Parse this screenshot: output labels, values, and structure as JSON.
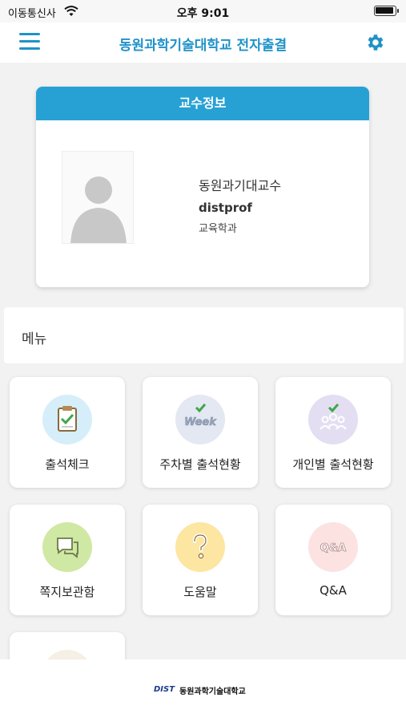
{
  "status_bar": {
    "carrier": "이동통신사",
    "time": "오후 9:01"
  },
  "navbar": {
    "title": "동원과학기술대학교 전자출결",
    "menu_icon": "hamburger-icon",
    "settings_icon": "gear-icon"
  },
  "colors": {
    "brand": "#1f92c8",
    "card_header": "#27a1d4"
  },
  "professor": {
    "header": "교수정보",
    "name": "동원과기대교수",
    "user_id": "distprof",
    "department": "교육학과"
  },
  "menu": {
    "title": "메뉴",
    "items": [
      {
        "label": "출석체크",
        "icon": "clipboard-check-icon"
      },
      {
        "label": "주차별 출석현황",
        "icon": "week-icon"
      },
      {
        "label": "개인별 출석현황",
        "icon": "people-check-icon"
      },
      {
        "label": "쪽지보관함",
        "icon": "message-icon"
      },
      {
        "label": "도움말",
        "icon": "question-icon"
      },
      {
        "label": "Q&A",
        "icon": "qna-icon"
      }
    ]
  },
  "footer": {
    "logo_text": "DIST",
    "school_name": "동원과학기술대학교"
  }
}
